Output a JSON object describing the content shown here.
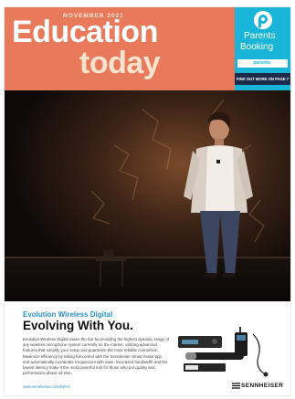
{
  "masthead": {
    "issue_date": "NOVEMBER 2021",
    "title_line1": "Education",
    "title_line2": "today",
    "bg_color": "#e8795a"
  },
  "sidebar_ad": {
    "logo_icon": "parents-booking-p-logo",
    "name_line1": "Parents",
    "name_line2": "Booking",
    "url": "parents-booking.co.uk",
    "cta": "FIND OUT MORE ON PAGE 7",
    "bg_color": "#19b5d8"
  },
  "advert": {
    "kicker": "Evolution Wireless Digital",
    "headline": "Evolving With You.",
    "body": "Evolution Wireless Digital raises the bar by providing the highest dynamic range of any wireless microphone system currently on the market, utilizing advanced features that simplify your setup and guarantee the most reliable connection. Maximize efficiency by taking full control with the Sennheiser Smart Assist app and automatically coordinate frequencies with ease. Increased bandwidth and the lowest latency make it the most powerful tool for those who put quality and performance above all else.",
    "link": "www.sennheiser.com/EW-D",
    "brand": "SENNHEISER",
    "kicker_color": "#2a8fc8"
  }
}
